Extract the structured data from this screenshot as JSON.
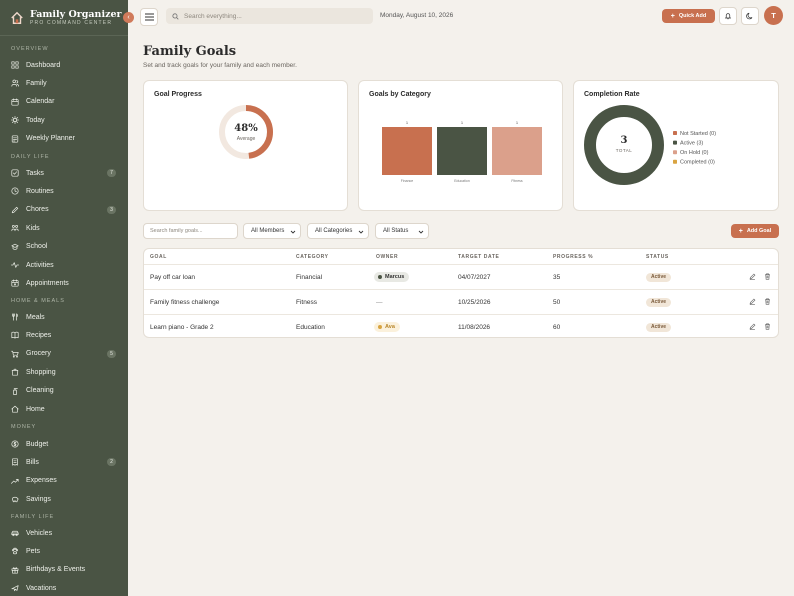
{
  "app": {
    "name": "Family Organizer",
    "subtitle": "PRO COMMAND CENTER",
    "collapse_glyph": "‹"
  },
  "sidebar": {
    "sections": [
      {
        "label": "OVERVIEW",
        "items": [
          {
            "label": "Dashboard",
            "icon": "grid-icon"
          },
          {
            "label": "Family",
            "icon": "users-icon"
          },
          {
            "label": "Calendar",
            "icon": "calendar-icon"
          },
          {
            "label": "Today",
            "icon": "sun-icon"
          },
          {
            "label": "Weekly Planner",
            "icon": "planner-icon"
          }
        ]
      },
      {
        "label": "DAILY LIFE",
        "items": [
          {
            "label": "Tasks",
            "icon": "checkbox-icon",
            "badge": "7"
          },
          {
            "label": "Routines",
            "icon": "clock-icon"
          },
          {
            "label": "Chores",
            "icon": "pencil-icon",
            "badge": "3"
          },
          {
            "label": "Kids",
            "icon": "kids-icon"
          },
          {
            "label": "School",
            "icon": "school-icon"
          },
          {
            "label": "Activities",
            "icon": "activity-icon"
          },
          {
            "label": "Appointments",
            "icon": "appointment-icon"
          }
        ]
      },
      {
        "label": "HOME & MEALS",
        "items": [
          {
            "label": "Meals",
            "icon": "utensils-icon"
          },
          {
            "label": "Recipes",
            "icon": "book-icon"
          },
          {
            "label": "Grocery",
            "icon": "cart-icon",
            "badge": "5"
          },
          {
            "label": "Shopping",
            "icon": "bag-icon"
          },
          {
            "label": "Cleaning",
            "icon": "spray-icon"
          },
          {
            "label": "Home",
            "icon": "home-icon"
          }
        ]
      },
      {
        "label": "MONEY",
        "items": [
          {
            "label": "Budget",
            "icon": "dollar-icon"
          },
          {
            "label": "Bills",
            "icon": "receipt-icon",
            "badge": "2"
          },
          {
            "label": "Expenses",
            "icon": "trend-icon"
          },
          {
            "label": "Savings",
            "icon": "piggy-icon"
          }
        ]
      },
      {
        "label": "FAMILY LIFE",
        "items": [
          {
            "label": "Vehicles",
            "icon": "car-icon"
          },
          {
            "label": "Pets",
            "icon": "paw-icon"
          },
          {
            "label": "Birthdays & Events",
            "icon": "gift-icon"
          },
          {
            "label": "Vacations",
            "icon": "plane-icon"
          }
        ]
      }
    ]
  },
  "topbar": {
    "search_placeholder": "Search everything...",
    "date": "Monday, August 10, 2026",
    "quick_add_label": "Quick Add",
    "avatar_initial": "T"
  },
  "page": {
    "title": "Family Goals",
    "subtitle": "Set and track goals for your family and each member."
  },
  "cards": {
    "progress": {
      "title": "Goal Progress",
      "value": "48%",
      "label": "Average",
      "fraction": 0.48
    },
    "category": {
      "title": "Goals by Category"
    },
    "completion": {
      "title": "Completion Rate",
      "total": "3",
      "total_label": "TOTAL"
    }
  },
  "chart_data": [
    {
      "type": "bar",
      "title": "Goals by Category",
      "categories": [
        "Finance",
        "Education",
        "Fitness"
      ],
      "values": [
        1,
        1,
        1
      ],
      "colors": [
        "#c8704f",
        "#4a5444",
        "#dba08b"
      ],
      "ylim": [
        0,
        1
      ]
    },
    {
      "type": "pie",
      "title": "Completion Rate",
      "categories": [
        "Not Started (0)",
        "Active (3)",
        "On Hold (0)",
        "Completed (0)"
      ],
      "values": [
        0,
        3,
        0,
        0
      ],
      "colors": [
        "#c8704f",
        "#4a5444",
        "#dba08b",
        "#d9a441"
      ],
      "legend": "right"
    }
  ],
  "filters": {
    "search_placeholder": "Search family goals...",
    "members": "All Members",
    "categories": "All Categories",
    "status": "All Status",
    "add_label": "Add Goal"
  },
  "table": {
    "headers": [
      "GOAL",
      "CATEGORY",
      "OWNER",
      "TARGET DATE",
      "PROGRESS %",
      "STATUS"
    ],
    "rows": [
      {
        "goal": "Pay off car loan",
        "category": "Financial",
        "owner": "Marcus",
        "owner_color": "#4a5444",
        "owner_bg": "#e8e9e4",
        "target": "04/07/2027",
        "progress": "35",
        "status": "Active"
      },
      {
        "goal": "Family fitness challenge",
        "category": "Fitness",
        "owner": "—",
        "owner_color": "",
        "owner_bg": "",
        "target": "10/25/2026",
        "progress": "50",
        "status": "Active"
      },
      {
        "goal": "Learn piano - Grade 2",
        "category": "Education",
        "owner": "Ava",
        "owner_color": "#d9a441",
        "owner_bg": "#fbf1dc",
        "target": "11/08/2026",
        "progress": "60",
        "status": "Active"
      }
    ]
  },
  "colors": {
    "sidebar": "#4a5444",
    "accent": "#c8704f",
    "background": "#f4f1ec"
  }
}
